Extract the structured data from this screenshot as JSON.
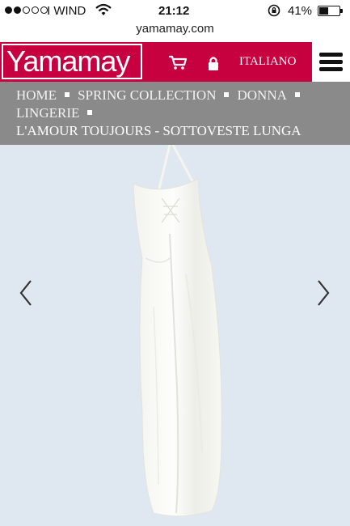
{
  "status_bar": {
    "carrier": "I WIND",
    "time": "21:12",
    "battery_percent": "41%",
    "battery_level": 0.41,
    "signal_bars_filled": 2,
    "signal_bars_total": 5
  },
  "browser": {
    "url": "yamamay.com"
  },
  "header": {
    "logo_text": "Yamamay",
    "language": "ITALIANO",
    "brand_color": "#c7003f",
    "icons": [
      "cart-icon",
      "padlock-icon",
      "hamburger-menu-icon"
    ]
  },
  "breadcrumb": {
    "items": [
      "HOME",
      "SPRING COLLECTION",
      "DONNA",
      "LINGERIE"
    ],
    "current": "L'AMOUR TOUJOURS - SOTTOVESTE LUNGA"
  },
  "product": {
    "image": "white-long-slip-dress",
    "prev_icon": "chevron-left-icon",
    "next_icon": "chevron-right-icon"
  }
}
